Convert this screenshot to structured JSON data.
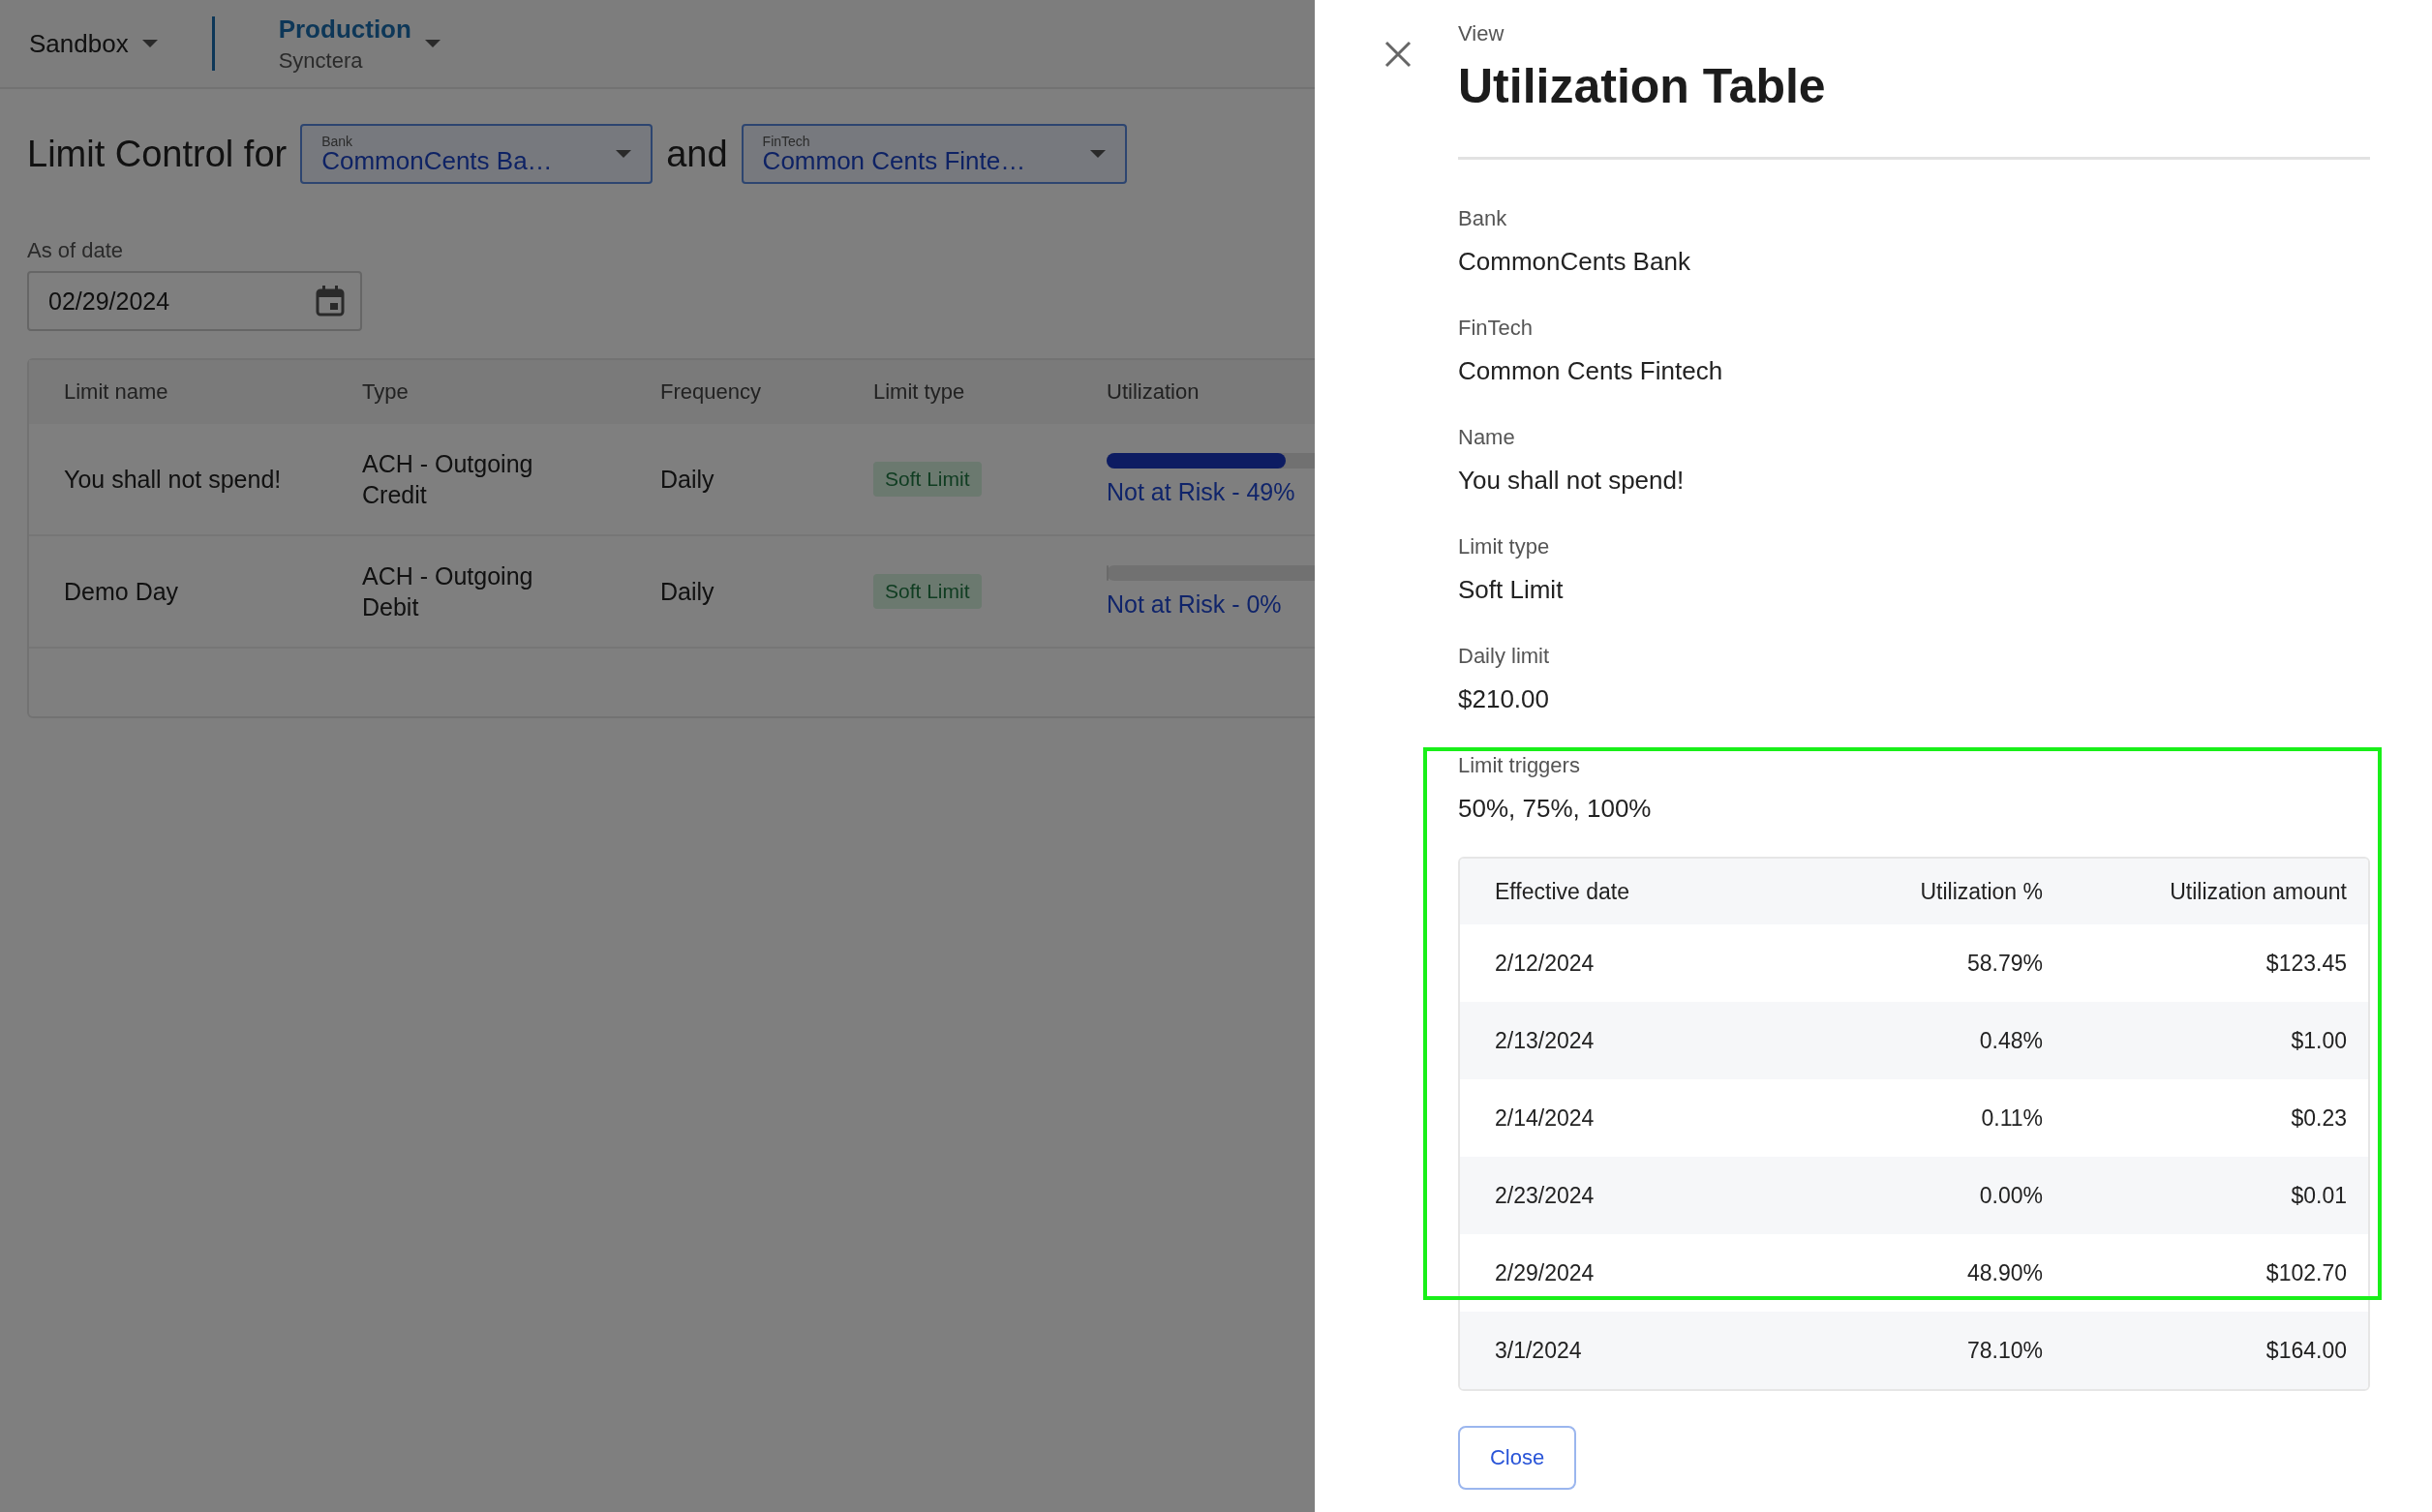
{
  "header": {
    "environment": "Sandbox",
    "org": {
      "name": "Production",
      "subtitle": "Synctera"
    }
  },
  "page": {
    "title_prefix": "Limit Control for",
    "bank_select": {
      "label": "Bank",
      "value": "CommonCents Ba…"
    },
    "joiner": "and",
    "fintech_select": {
      "label": "FinTech",
      "value": "Common Cents Finte…"
    },
    "date_field": {
      "label": "As of date",
      "value": "02/29/2024"
    },
    "table": {
      "columns": [
        "Limit name",
        "Type",
        "Frequency",
        "Limit type",
        "Utilization"
      ],
      "rows": [
        {
          "name": "You shall not spend!",
          "type": "ACH - Outgoing Credit",
          "frequency": "Daily",
          "limit_type": "Soft Limit",
          "level": 0.49,
          "status": "Not at Risk - 49%"
        },
        {
          "name": "Demo Day",
          "type": "ACH - Outgoing Debit",
          "frequency": "Daily",
          "limit_type": "Soft Limit",
          "level": 0,
          "status": "Not at Risk - 0%"
        }
      ]
    }
  },
  "drawer": {
    "eyebrow": "View",
    "title": "Utilization Table",
    "fields": [
      {
        "label": "Bank",
        "value": "CommonCents Bank"
      },
      {
        "label": "FinTech",
        "value": "Common Cents Fintech"
      },
      {
        "label": "Name",
        "value": "You shall not spend!"
      },
      {
        "label": "Limit type",
        "value": "Soft Limit"
      },
      {
        "label": "Daily limit",
        "value": "$210.00"
      },
      {
        "label": "Limit triggers",
        "value": "50%, 75%, 100%"
      }
    ],
    "table": {
      "columns": [
        "Effective date",
        "Utilization %",
        "Utilization amount"
      ],
      "rows": [
        [
          "2/12/2024",
          "58.79%",
          "$123.45"
        ],
        [
          "2/13/2024",
          "0.48%",
          "$1.00"
        ],
        [
          "2/14/2024",
          "0.11%",
          "$0.23"
        ],
        [
          "2/23/2024",
          "0.00%",
          "$0.01"
        ],
        [
          "2/29/2024",
          "48.90%",
          "$102.70"
        ],
        [
          "3/1/2024",
          "78.10%",
          "$164.00"
        ]
      ]
    },
    "close_button": "Close"
  }
}
